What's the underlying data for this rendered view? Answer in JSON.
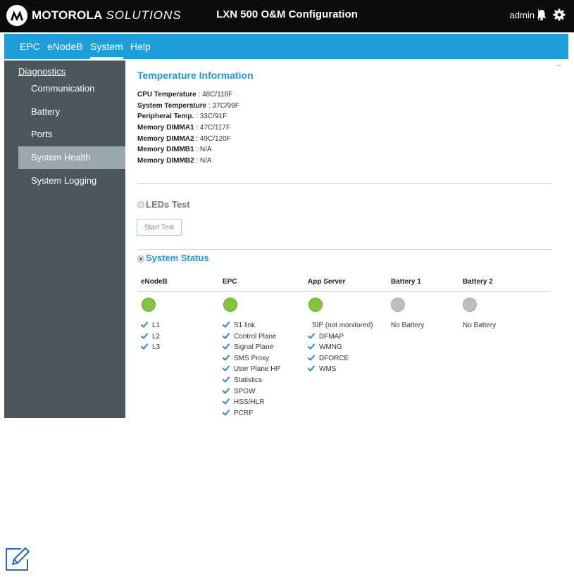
{
  "header": {
    "brand_bold": "MOTOROLA",
    "brand_light": "SOLUTIONS",
    "title": "LXN 500 O&M Configuration",
    "user": "admin"
  },
  "nav": {
    "items": [
      "EPC",
      "eNodeB",
      "System",
      "Help"
    ],
    "active": "System"
  },
  "sidebar": {
    "heading": "Diagnostics",
    "items": [
      "Communication",
      "Battery",
      "Ports",
      "System Health",
      "System Logging"
    ],
    "active": "System Health"
  },
  "temperature": {
    "title": "Temperature Information",
    "rows": [
      {
        "label": "CPU Temperature",
        "value": " : 48C/118F"
      },
      {
        "label": "System Temperature",
        "value": " : 37C/99F"
      },
      {
        "label": "Peripheral Temp.",
        "value": " : 33C/91F"
      },
      {
        "label": "Memory DIMMA1",
        "value": " : 47C/117F"
      },
      {
        "label": "Memory DIMMA2",
        "value": " : 49C/120F"
      },
      {
        "label": "Memory DIMMB1",
        "value": " : N/A"
      },
      {
        "label": "Memory DIMMB2",
        "value": " : N/A"
      }
    ]
  },
  "leds_test": {
    "title": "LEDs Test",
    "button": "Start Test"
  },
  "system_status": {
    "title": "System Status",
    "columns": [
      {
        "name": "eNodeB",
        "status": "green",
        "items": [
          "L1",
          "L2",
          "L3"
        ],
        "checks": [
          true,
          true,
          true
        ]
      },
      {
        "name": "EPC",
        "status": "green",
        "items": [
          "S1 link",
          "Control Plane",
          "Signal Plane",
          "SMS Proxy",
          "User Plane HP",
          "Statistics",
          "SPGW",
          "HSS/HLR",
          "PCRF"
        ],
        "checks": [
          true,
          true,
          true,
          true,
          true,
          true,
          true,
          true,
          true
        ]
      },
      {
        "name": "App Server",
        "status": "green",
        "items": [
          "SIP (not monitored)",
          "DFMAP",
          "WMNG",
          "DFORCE",
          "WMS"
        ],
        "checks": [
          false,
          true,
          true,
          true,
          true
        ]
      },
      {
        "name": "Battery 1",
        "status": "grey",
        "items": [
          "No Battery"
        ],
        "checks": [
          false
        ]
      },
      {
        "name": "Battery 2",
        "status": "grey",
        "items": [
          "No Battery"
        ],
        "checks": [
          false
        ]
      }
    ]
  },
  "colors": {
    "nav_blue": "#1e9fd9",
    "sidebar": "#4b565d",
    "sidebar_active": "#9aa6ad",
    "title_blue": "#2197d3",
    "led_green": "#82c341",
    "led_grey": "#bdbdbd",
    "check_blue": "#2a86c9"
  },
  "icons": [
    "motorola-logo-icon",
    "bell-icon",
    "gear-icon",
    "check-icon",
    "note-edit-icon"
  ]
}
